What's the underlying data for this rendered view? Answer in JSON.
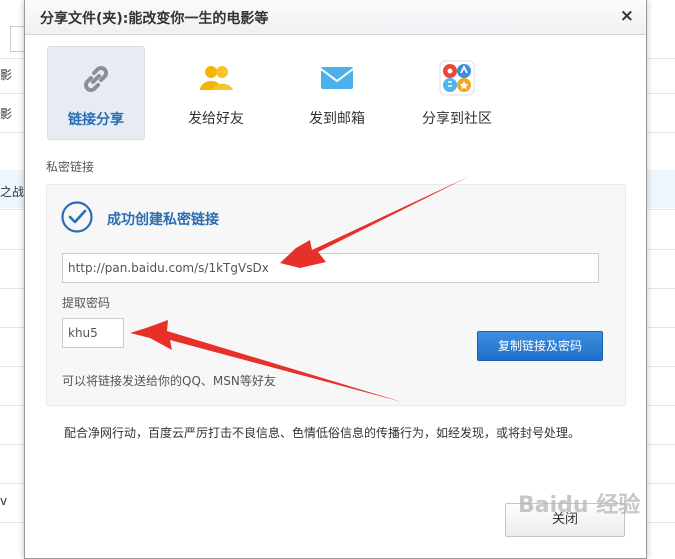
{
  "background": {
    "row_labels": [
      "影",
      "影",
      "之战",
      "v"
    ]
  },
  "dialog": {
    "title": "分享文件(夹):能改变你一生的电影等",
    "close_glyph": "×",
    "tabs": [
      {
        "label": "链接分享",
        "icon": "link-icon",
        "active": true
      },
      {
        "label": "发给好友",
        "icon": "friends-icon",
        "active": false
      },
      {
        "label": "发到邮箱",
        "icon": "mail-icon",
        "active": false
      },
      {
        "label": "分享到社区",
        "icon": "community-icon",
        "active": false
      }
    ],
    "section_label": "私密链接",
    "success_text": "成功创建私密链接",
    "link_value": "http://pan.baidu.com/s/1kTgVsDx",
    "code_label": "提取密码",
    "code_value": "khu5",
    "copy_button": "复制链接及密码",
    "hint": "可以将链接发送给你的QQ、MSN等好友",
    "notice": "配合净网行动，百度云严厉打击不良信息、色情低俗信息的传播行为，如经发现，或将封号处理。",
    "close_button": "关闭"
  },
  "watermark": "Baidu 经验",
  "colors": {
    "accent": "#2a6db5",
    "button_blue": "#1e6fc8",
    "arrow_red": "#e8302a"
  }
}
